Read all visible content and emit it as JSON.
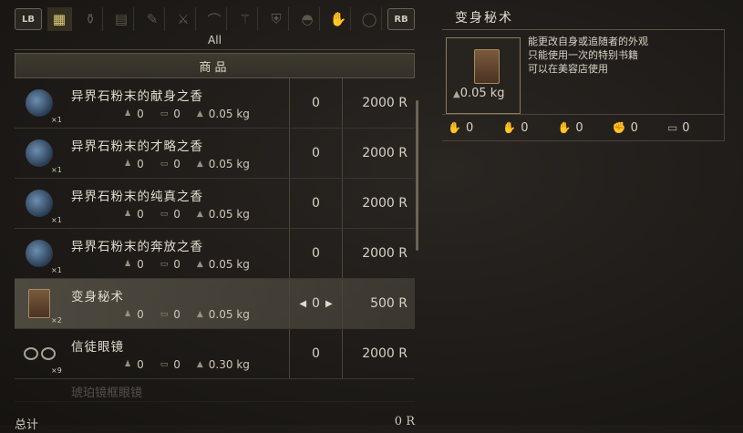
{
  "topbar": {
    "lb": "LB",
    "rb": "RB",
    "categories": [
      "all-grid-icon",
      "pouch-icon",
      "scroll-icon",
      "feather-icon",
      "sword-icon",
      "bow-icon",
      "staff-icon",
      "armor-icon",
      "helmet-icon",
      "gauntlet-icon",
      "ring-icon"
    ]
  },
  "filter_label": "All",
  "list": {
    "header": "商品",
    "items": [
      {
        "name": "异界石粉末的献身之香",
        "qty": "×1",
        "a": "0",
        "b": "0",
        "weight": "0.05 kg",
        "count": "0",
        "price": "2000 R",
        "icon": "powder"
      },
      {
        "name": "异界石粉末的才略之香",
        "qty": "×1",
        "a": "0",
        "b": "0",
        "weight": "0.05 kg",
        "count": "0",
        "price": "2000 R",
        "icon": "powder"
      },
      {
        "name": "异界石粉末的纯真之香",
        "qty": "×1",
        "a": "0",
        "b": "0",
        "weight": "0.05 kg",
        "count": "0",
        "price": "2000 R",
        "icon": "powder"
      },
      {
        "name": "异界石粉末的奔放之香",
        "qty": "×1",
        "a": "0",
        "b": "0",
        "weight": "0.05 kg",
        "count": "0",
        "price": "2000 R",
        "icon": "powder"
      },
      {
        "name": "变身秘术",
        "qty": "×2",
        "a": "0",
        "b": "0",
        "weight": "0.05 kg",
        "count": "0",
        "price": "500 R",
        "icon": "book",
        "selected": true
      },
      {
        "name": "信徒眼镜",
        "qty": "×9",
        "a": "0",
        "b": "0",
        "weight": "0.30 kg",
        "count": "0",
        "price": "2000 R",
        "icon": "glasses"
      }
    ],
    "faded_item": "琥珀镜框眼镜"
  },
  "total": {
    "label": "总计",
    "value": "0 R"
  },
  "detail": {
    "title": "变身秘术",
    "weight": "0.05 kg",
    "description": [
      "能更改自身或追随者的外观",
      "只能使用一次的特别书籍",
      "可以在美容店使用"
    ],
    "stats": [
      "0",
      "0",
      "0",
      "0",
      "0"
    ]
  },
  "colors": {
    "accent": "#e6d27a",
    "panel": "#1d1a17"
  }
}
